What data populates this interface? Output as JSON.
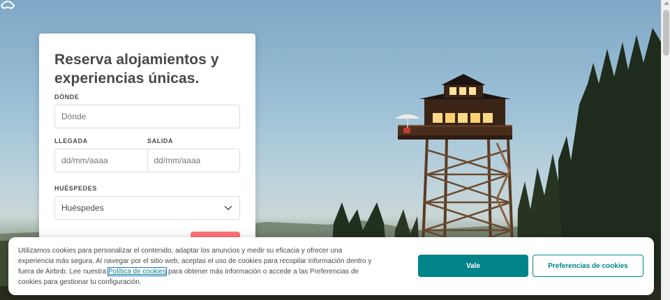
{
  "hero": {
    "logo_icon": "airbnb-belo-icon",
    "scene": "fire-lookout-tower-forest"
  },
  "search_card": {
    "headline_line1": "Reserva alojamientos y",
    "headline_line2": "experiencias únicas.",
    "where": {
      "label": "DÓNDE",
      "placeholder": "Dónde"
    },
    "checkin": {
      "label": "LLEGADA",
      "placeholder": "dd/mm/aaaa"
    },
    "checkout": {
      "label": "SALIDA",
      "placeholder": "dd/mm/aaaa"
    },
    "guests": {
      "label": "HUÉSPEDES",
      "value": "Huéspedes",
      "icon": "chevron-down-icon"
    },
    "search_button_color": "#ff5a5f"
  },
  "cookie_banner": {
    "text_before_link": "Utilizamos cookies para personalizar el contenido, adaptar los anuncios y medir su eficacia y ofrecer una experiencia más segura. Al navegar por el sitio web, aceptas el uso de cookies para recopilar información dentro y fuera de Airbnb. Lee nuestra ",
    "link_text": "Política de cookies",
    "text_after_link": " para obtener más información o accede a las Preferencias de cookies para gestionar tu configuración.",
    "accept_label": "Vale",
    "preferences_label": "Preferencias de cookies",
    "accent_color": "#008489"
  }
}
